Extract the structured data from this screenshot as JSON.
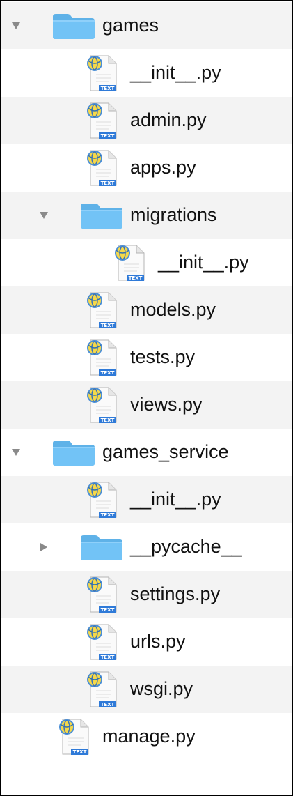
{
  "colors": {
    "stripe": "#f3f3f3",
    "folder_front": "#72c3f6",
    "folder_back": "#5fb2e8",
    "disclosure": "#8a8a8a",
    "text_badge": "#2f7ad8"
  },
  "icons": {
    "folder": "folder-icon",
    "python_file": "python-file-icon"
  },
  "file_tree": [
    {
      "name": "games",
      "type": "folder",
      "depth": 0,
      "disclosure": "expanded"
    },
    {
      "name": "__init__.py",
      "type": "file",
      "depth": 1,
      "badge": "TEXT"
    },
    {
      "name": "admin.py",
      "type": "file",
      "depth": 1,
      "badge": "TEXT"
    },
    {
      "name": "apps.py",
      "type": "file",
      "depth": 1,
      "badge": "TEXT"
    },
    {
      "name": "migrations",
      "type": "folder",
      "depth": 1,
      "disclosure": "expanded"
    },
    {
      "name": "__init__.py",
      "type": "file",
      "depth": 2,
      "badge": "TEXT"
    },
    {
      "name": "models.py",
      "type": "file",
      "depth": 1,
      "badge": "TEXT"
    },
    {
      "name": "tests.py",
      "type": "file",
      "depth": 1,
      "badge": "TEXT"
    },
    {
      "name": "views.py",
      "type": "file",
      "depth": 1,
      "badge": "TEXT"
    },
    {
      "name": "games_service",
      "type": "folder",
      "depth": 0,
      "disclosure": "expanded"
    },
    {
      "name": "__init__.py",
      "type": "file",
      "depth": 1,
      "badge": "TEXT"
    },
    {
      "name": "__pycache__",
      "type": "folder",
      "depth": 1,
      "disclosure": "collapsed"
    },
    {
      "name": "settings.py",
      "type": "file",
      "depth": 1,
      "badge": "TEXT"
    },
    {
      "name": "urls.py",
      "type": "file",
      "depth": 1,
      "badge": "TEXT"
    },
    {
      "name": "wsgi.py",
      "type": "file",
      "depth": 1,
      "badge": "TEXT"
    },
    {
      "name": "manage.py",
      "type": "file",
      "depth": 0,
      "badge": "TEXT"
    }
  ]
}
